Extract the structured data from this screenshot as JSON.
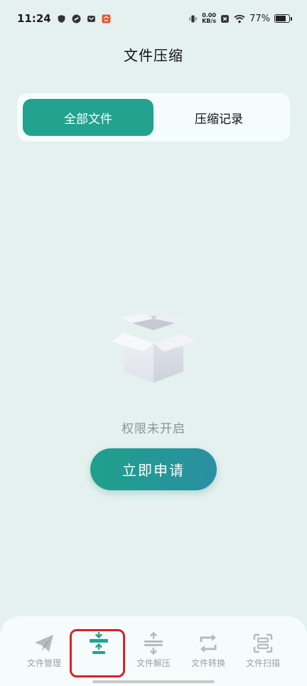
{
  "status_bar": {
    "time": "11:24",
    "net_speed_value": "0.00",
    "net_speed_unit": "KB/s",
    "battery": "77%",
    "battery_level": 0.77,
    "icons": [
      "shield-icon",
      "link-icon",
      "mail-icon",
      "app-badge-icon",
      "vibrate-icon",
      "sim-x-icon",
      "wifi-icon",
      "battery-icon"
    ]
  },
  "header": {
    "title": "文件压缩"
  },
  "tabs": [
    {
      "label": "全部文件",
      "active": true
    },
    {
      "label": "压缩记录",
      "active": false
    }
  ],
  "empty_state": {
    "icon": "empty-box-icon",
    "message": "权限未开启",
    "button_label": "立即申请"
  },
  "bottom_nav": [
    {
      "label": "文件管理",
      "icon": "paper-plane-icon",
      "active": false
    },
    {
      "label": "",
      "icon": "compress-icon",
      "active": true
    },
    {
      "label": "文件解压",
      "icon": "decompress-icon",
      "active": false
    },
    {
      "label": "文件转换",
      "icon": "convert-icon",
      "active": false
    },
    {
      "label": "文件扫描",
      "icon": "scan-icon",
      "active": false
    }
  ],
  "colors": {
    "accent": "#22a28f",
    "background": "#e4f1ef",
    "highlight": "#d8222a"
  }
}
